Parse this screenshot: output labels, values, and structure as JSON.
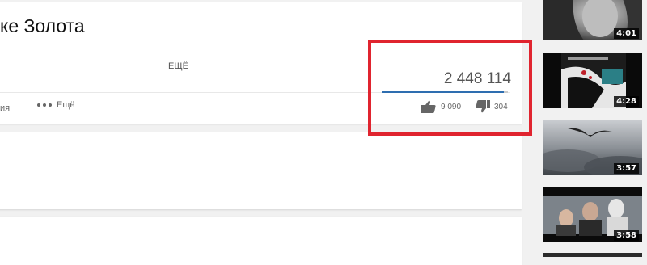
{
  "video": {
    "title": "ке Золота",
    "views": "2 448 114",
    "like_ratio": 0.9665,
    "likes": "9 090",
    "dislikes": "304"
  },
  "actions": {
    "share_tail": "ия",
    "more_label": "Ещё"
  },
  "description": {
    "show_more_label": "ЕЩЁ"
  },
  "sidebar": {
    "thumbnails": [
      {
        "duration": "4:01"
      },
      {
        "duration": "4:28"
      },
      {
        "duration": "3:57"
      },
      {
        "duration": "3:58"
      }
    ]
  },
  "colors": {
    "highlight": "#e0242f",
    "view_bar_fill": "#2e6eb0"
  }
}
